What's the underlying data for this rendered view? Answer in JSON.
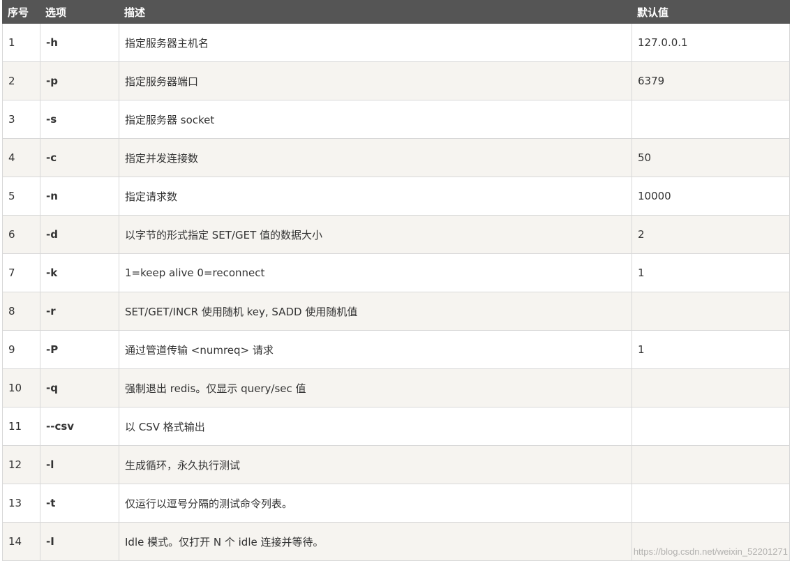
{
  "table": {
    "headers": [
      "序号",
      "选项",
      "描述",
      "默认值"
    ],
    "rows": [
      {
        "num": "1",
        "option": "-h",
        "desc": "指定服务器主机名",
        "default": "127.0.0.1"
      },
      {
        "num": "2",
        "option": "-p",
        "desc": "指定服务器端口",
        "default": "6379"
      },
      {
        "num": "3",
        "option": "-s",
        "desc": "指定服务器 socket",
        "default": ""
      },
      {
        "num": "4",
        "option": "-c",
        "desc": "指定并发连接数",
        "default": "50"
      },
      {
        "num": "5",
        "option": "-n",
        "desc": "指定请求数",
        "default": "10000"
      },
      {
        "num": "6",
        "option": "-d",
        "desc": "以字节的形式指定 SET/GET 值的数据大小",
        "default": "2"
      },
      {
        "num": "7",
        "option": "-k",
        "desc": "1=keep alive 0=reconnect",
        "default": "1"
      },
      {
        "num": "8",
        "option": "-r",
        "desc": "SET/GET/INCR 使用随机 key, SADD 使用随机值",
        "default": ""
      },
      {
        "num": "9",
        "option": "-P",
        "desc": "通过管道传输 <numreq> 请求",
        "default": "1"
      },
      {
        "num": "10",
        "option": "-q",
        "desc": "强制退出 redis。仅显示 query/sec 值",
        "default": ""
      },
      {
        "num": "11",
        "option": "--csv",
        "desc": "以 CSV 格式输出",
        "default": ""
      },
      {
        "num": "12",
        "option": "-l",
        "desc": "生成循环，永久执行测试",
        "default": ""
      },
      {
        "num": "13",
        "option": "-t",
        "desc": "仅运行以逗号分隔的测试命令列表。",
        "default": ""
      },
      {
        "num": "14",
        "option": "-I",
        "desc": "Idle 模式。仅打开 N 个 idle 连接并等待。",
        "default": ""
      }
    ]
  },
  "watermark": "https://blog.csdn.net/weixin_52201271",
  "colors": {
    "header_bg": "#555555",
    "header_text": "#ffffff",
    "row_alt_bg": "#f6f4f0",
    "border": "#d8d8d8"
  }
}
